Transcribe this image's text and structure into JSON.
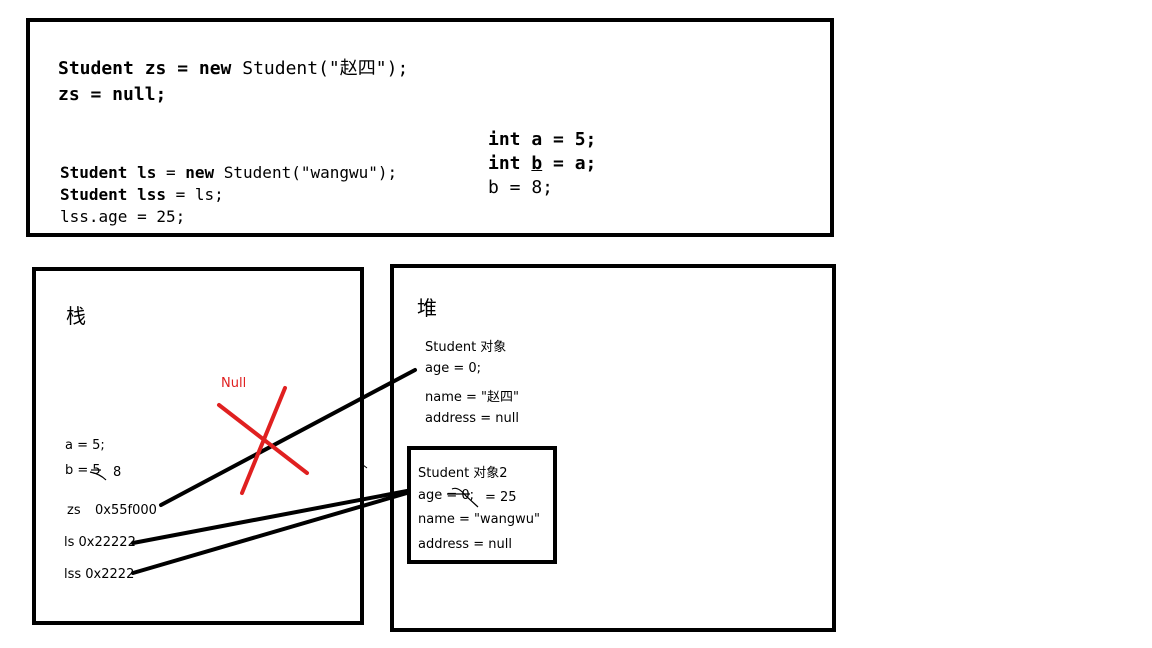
{
  "code": {
    "line1": {
      "kw1": "Student zs = new ",
      "rest": "Student(\"赵四\");"
    },
    "line2": {
      "kw1": "zs = null;",
      "rest": ""
    },
    "line3": {
      "kw1": "Student ls",
      "mid": " = ",
      "kw2": "new",
      "rest": " Student(\"wangwu\");"
    },
    "line4": {
      "kw1": "Student lss",
      "rest": " = ls;"
    },
    "line5": "lss.age = 25;",
    "right1": {
      "kw": "int",
      "var": " a",
      "rest": " = 5;"
    },
    "right2": {
      "kw": "int",
      "var": "b",
      "rest": " = a;"
    },
    "right3": "b = 8;"
  },
  "stack": {
    "title": "栈",
    "null_label": "Null",
    "a": "a = 5;",
    "b": "b = 5",
    "b_new": "8",
    "zs": "zs",
    "zs_addr": "0x55f000",
    "ls": "ls 0x22222",
    "lss": "lss 0x2222"
  },
  "heap": {
    "title": "堆",
    "obj1": {
      "title": "Student 对象",
      "age": "age = 0;",
      "name": "name = \"赵四\"",
      "address": "address = null"
    },
    "obj2": {
      "title": "Student 对象2",
      "age": "age = 0;",
      "age_new": "= 25",
      "name": "name = \"wangwu\"",
      "address": "address = null"
    }
  },
  "colors": {
    "cross": "#e02020",
    "null_label": "#e02020",
    "lines": "#000000"
  }
}
